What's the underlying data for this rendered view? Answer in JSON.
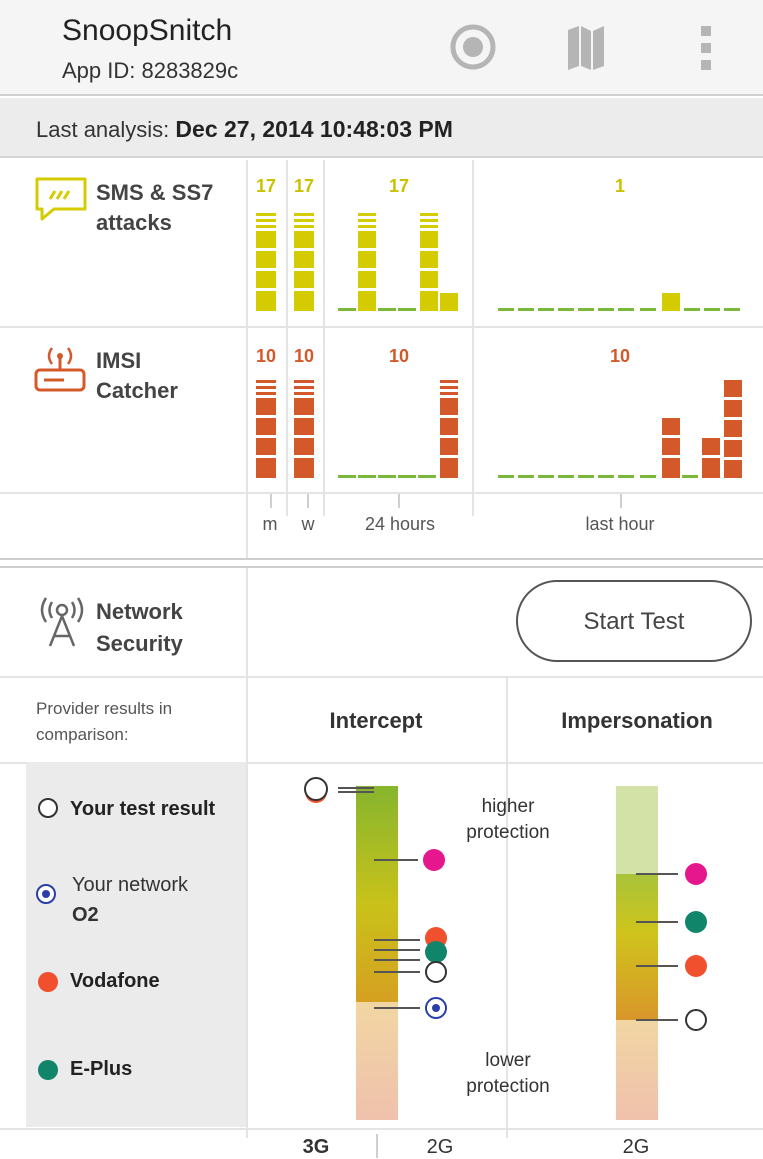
{
  "header": {
    "title": "SnoopSnitch",
    "app_id": "App ID: 8283829c"
  },
  "last_analysis": {
    "label": "Last analysis:",
    "value": "Dec 27, 2014 10:48:03 PM"
  },
  "attacks": [
    {
      "label_line1": "SMS & SS7",
      "label_line2": "attacks",
      "counts": [
        "17",
        "17",
        "17",
        "1"
      ],
      "color": "#d4cc00"
    },
    {
      "label_line1": "IMSI",
      "label_line2": "Catcher",
      "counts": [
        "10",
        "10",
        "10",
        "10"
      ],
      "color": "#d3582a"
    }
  ],
  "axis": {
    "m": "m",
    "w": "w",
    "day": "24 hours",
    "hour": "last hour"
  },
  "network": {
    "title_line1": "Network",
    "title_line2": "Security",
    "start_test": "Start Test"
  },
  "comparison": {
    "intro_line1": "Provider results in",
    "intro_line2": "comparison:",
    "intercept": "Intercept",
    "impersonation": "Impersonation"
  },
  "legend": {
    "your_test": "Your test result",
    "your_network_line1": "Your network",
    "your_network_line2": "O2",
    "vodafone": "Vodafone",
    "eplus": "E-Plus"
  },
  "annotations": {
    "higher_line1": "higher",
    "higher_line2": "protection",
    "lower_line1": "lower",
    "lower_line2": "protection"
  },
  "bottom": {
    "g3": "3G",
    "g2a": "2G",
    "g2b": "2G"
  },
  "colors": {
    "sms": "#d4cc00",
    "imsi": "#d3582a",
    "green": "#7bb83a",
    "magenta": "#e6168c",
    "vodafone": "#f0502d",
    "eplus": "#11856a",
    "o2": "#2b3ea8"
  },
  "icons": [
    "record-icon",
    "map-icon",
    "overflow-menu-icon",
    "sms-icon",
    "imsi-catcher-icon",
    "antenna-icon"
  ]
}
